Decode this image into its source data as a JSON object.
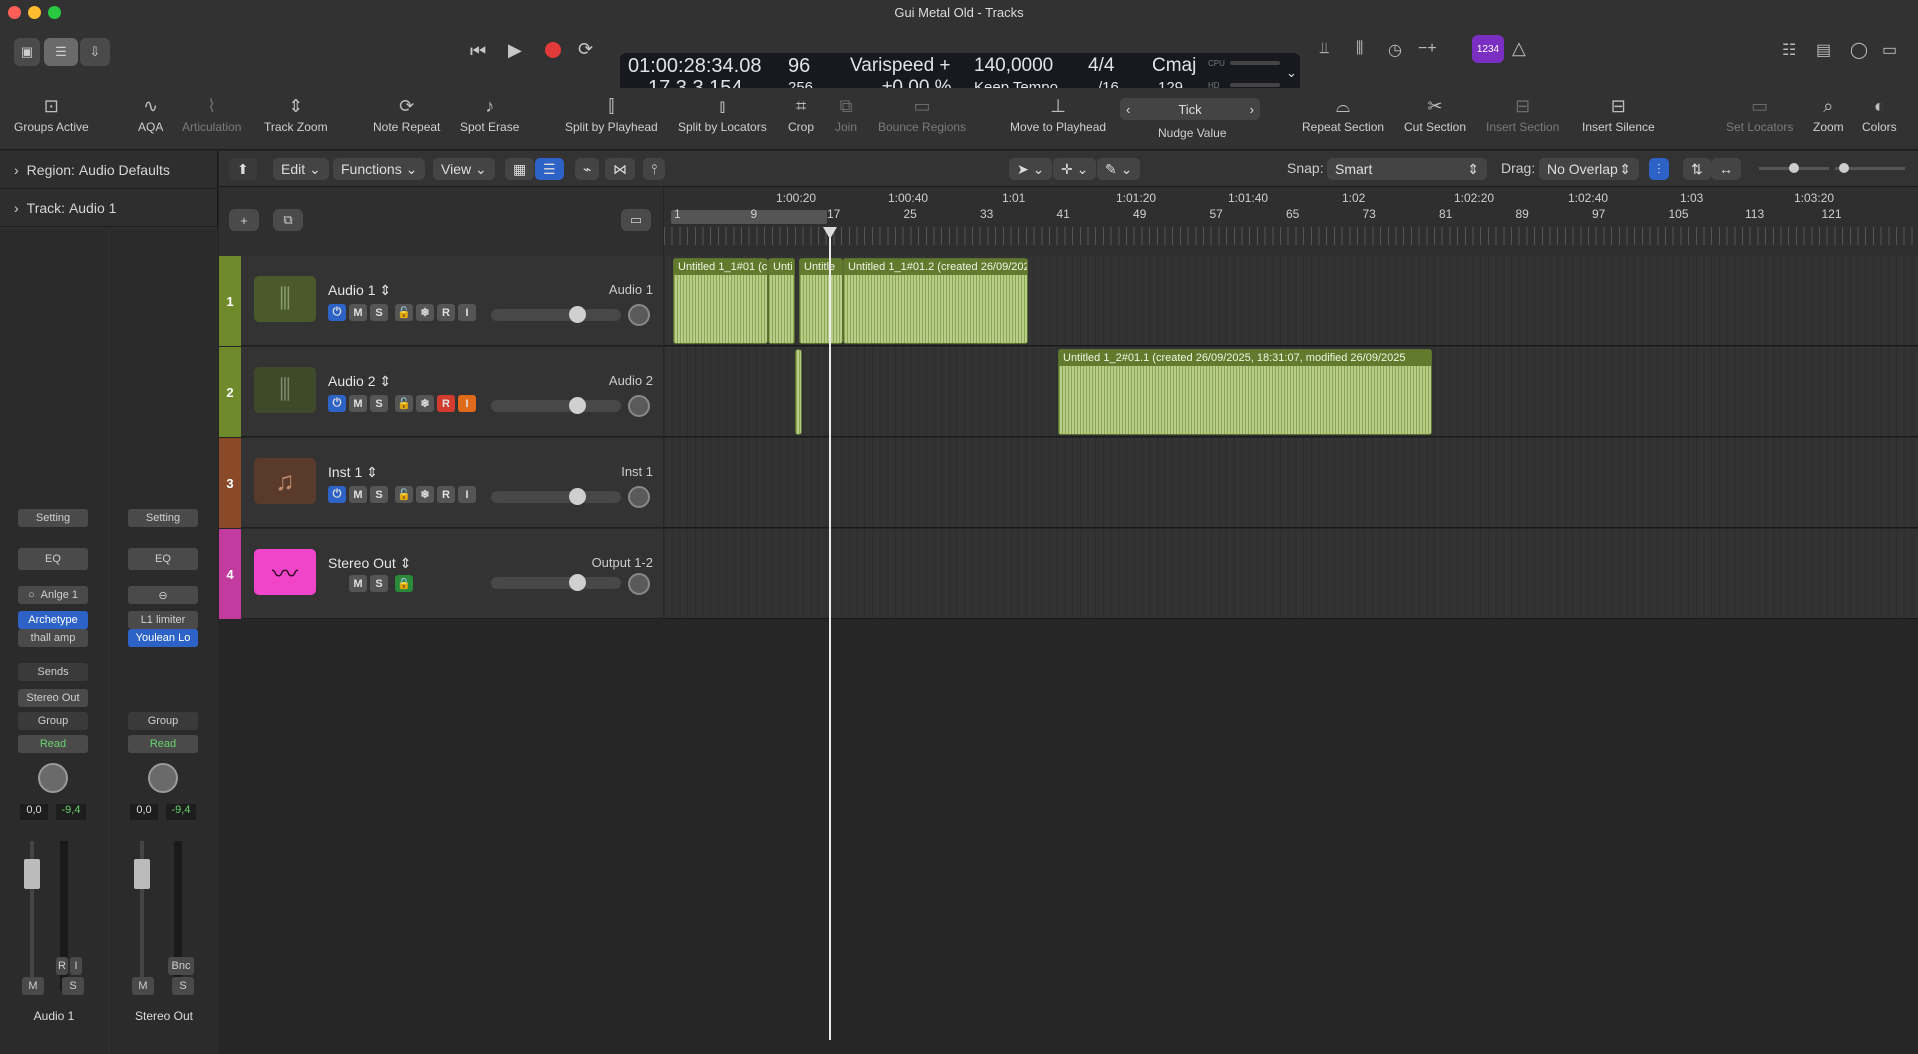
{
  "window": {
    "title": "Gui Metal Old - Tracks"
  },
  "lcd": {
    "time": "01:00:28:34.08",
    "bars": "17  3  3  154",
    "tempo_top": "96",
    "tempo_bottom": "256",
    "varispeed": "Varispeed +",
    "varispeed_pct": "±0,00 %",
    "bpm": "140,0000",
    "tempo_mode": "Keep Tempo",
    "sig_top": "4/4",
    "sig_bottom": "/16",
    "key": "Cmaj",
    "key_num": "129",
    "cpu": "CPU",
    "hd": "HD"
  },
  "badge": "1234",
  "toolbar": [
    "Groups Active",
    "AQA",
    "Articulation",
    "Track Zoom",
    "Note Repeat",
    "Spot Erase",
    "Split by Playhead",
    "Split by Locators",
    "Crop",
    "Join",
    "Bounce Regions",
    "Move to Playhead",
    "Nudge Value",
    "Repeat Section",
    "Cut Section",
    "Insert Section",
    "Insert Silence",
    "Set Locators",
    "Zoom",
    "Colors"
  ],
  "nudge": "Tick",
  "inspector": {
    "region_label": "Region:",
    "region_value": "Audio Defaults",
    "track_label": "Track:",
    "track_value": "Audio 1"
  },
  "strip1": {
    "setting": "Setting",
    "eq": "EQ",
    "input": "Anlge 1",
    "plugin1": "Archetype",
    "plugin2": "thall amp",
    "sends": "Sends",
    "output": "Stereo Out",
    "group": "Group",
    "auto": "Read",
    "pan": "0,0",
    "peak": "-9,4",
    "r": "R",
    "i": "I",
    "m": "M",
    "s": "S",
    "name": "Audio 1"
  },
  "strip2": {
    "setting": "Setting",
    "eq": "EQ",
    "plugin1": "L1 limiter",
    "plugin2": "Youlean Lo",
    "group": "Group",
    "auto": "Read",
    "pan": "0,0",
    "peak": "-9,4",
    "bnc": "Bnc",
    "m": "M",
    "s": "S",
    "name": "Stereo Out"
  },
  "header": {
    "edit": "Edit",
    "functions": "Functions",
    "view": "View",
    "snap_label": "Snap:",
    "snap": "Smart",
    "drag_label": "Drag:",
    "drag": "No Overlap"
  },
  "ruler_time": [
    "1:00:20",
    "1:00:40",
    "1:01",
    "1:01:20",
    "1:01:40",
    "1:02",
    "1:02:20",
    "1:02:40",
    "1:03",
    "1:03:20"
  ],
  "ruler_bars": [
    "1",
    "9",
    "17",
    "25",
    "33",
    "41",
    "49",
    "57",
    "65",
    "73",
    "81",
    "89",
    "97",
    "105",
    "113",
    "121"
  ],
  "tracks": [
    {
      "num": "1",
      "name": "Audio 1",
      "output": "Audio 1",
      "color": "#6e8a2a"
    },
    {
      "num": "2",
      "name": "Audio 2",
      "output": "Audio 2",
      "color": "#6e8a2a"
    },
    {
      "num": "3",
      "name": "Inst 1",
      "output": "Inst 1",
      "color": "#8a4a2a"
    },
    {
      "num": "4",
      "name": "Stereo Out",
      "output": "Output 1-2",
      "color": "#c23c9f"
    }
  ],
  "regions": {
    "r1": "Untitled 1_1#01 (c",
    "r2": "Unti",
    "r3": "Untitle",
    "r4": "Untitled 1_1#01.2 (created 26/09/202",
    "r5": "Untitled 1_2#01.1 (created 26/09/2025, 18:31:07, modified 26/09/2025"
  }
}
